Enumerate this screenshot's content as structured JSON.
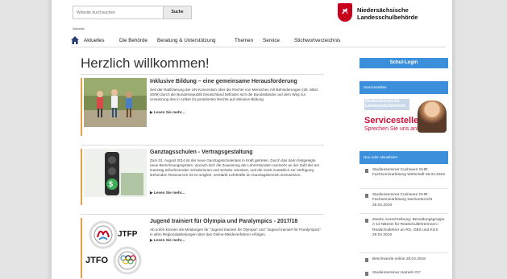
{
  "search": {
    "placeholder": "Website durchsuchen",
    "button": "Suche"
  },
  "logo": {
    "line1": "Niedersächsische",
    "line2": "Landesschulbehörde"
  },
  "breadcrumb": "Startseite",
  "nav": {
    "items": [
      "Aktuelles",
      "Die Behörde",
      "Beratung & Unterstützung",
      "Themen",
      "Service",
      "Stichwortverzeichnis"
    ]
  },
  "heading": "Herzlich willkommen!",
  "articles": [
    {
      "title": "Inklusive Bildung – eine gemeinsame Herausforderung",
      "text": "Seit der Ratifizierung der UN-Konvention über die Rechte von Menschen mit Behinderungen (26. März 2009) durch die Bundesrepublik Deutschland befinden sich die Bundesländer auf dem Weg zur Umsetzung des in Artikel 24 postulierten Rechts auf inklusive Bildung.",
      "more": "▶ Lesen Sie mehr..."
    },
    {
      "title": "Ganztagsschulen - Vertragsgestaltung",
      "text": "Zum 01. August 2014 ist der neue Ganztagsschulerlass in Kraft getreten. Durch das darin festgelegte neue Berechnungssystem, wonach sich die Zuweisung der Lehrerstunden nunmehr an der Zahl der am Ganztag teilnehmenden Schülerinnen und Schüler orientiert, und die somit zusätzlich zur Verfügung stehenden Ressourcen ist es möglich, verstärkt Lehrkräfte im Ganztagsbereich einzusetzen.",
      "more": "▶ Lesen Sie mehr..."
    },
    {
      "title": "Jugend trainiert für Olympia und Paralympics - 2017/18",
      "text": "Ab sofort können die Meldungen für \"Jugend trainiert für Olympia\" und \"Jugend trainiert für Paralympics\" in allen Regionalabteilungen über das Online-Meldeverfahren erfolgen.",
      "more": "▶ Lesen Sie mehr...",
      "logo_top": "JTFP",
      "logo_bottom": "JTFO"
    }
  ],
  "sidebar": {
    "login": "Schul-Login",
    "servicestellen": {
      "header": "Servicestellen",
      "banner1": "Niedersächsische",
      "banner2": "Landesschulbehörde",
      "big": "Servicestellen",
      "small": "Sprechen Sie uns an!"
    },
    "news_header": "Neu oder aktualisiert",
    "news": [
      "Studienseminar Cuxhaven GHR: Fachseminarleitung Wirtschaft 26.04.2018",
      "Studienseminar Cuxhaven GHR: Fachseminarleitung Sachunterricht 26.04.2018",
      "Zweite Ausschreibung: Besoldungsgruppe A 13 NBesO für Realschullehrerinnen / Realschullehrer an RS, OBS und KGS 25.04.2018",
      "Beschwerde online 25.04.2018",
      "Studienseminar Hameln GY:"
    ]
  },
  "colors": {
    "accent_blue": "#3c8fda",
    "brand_red": "#c8001e",
    "article_bar": "#e8a04a"
  }
}
